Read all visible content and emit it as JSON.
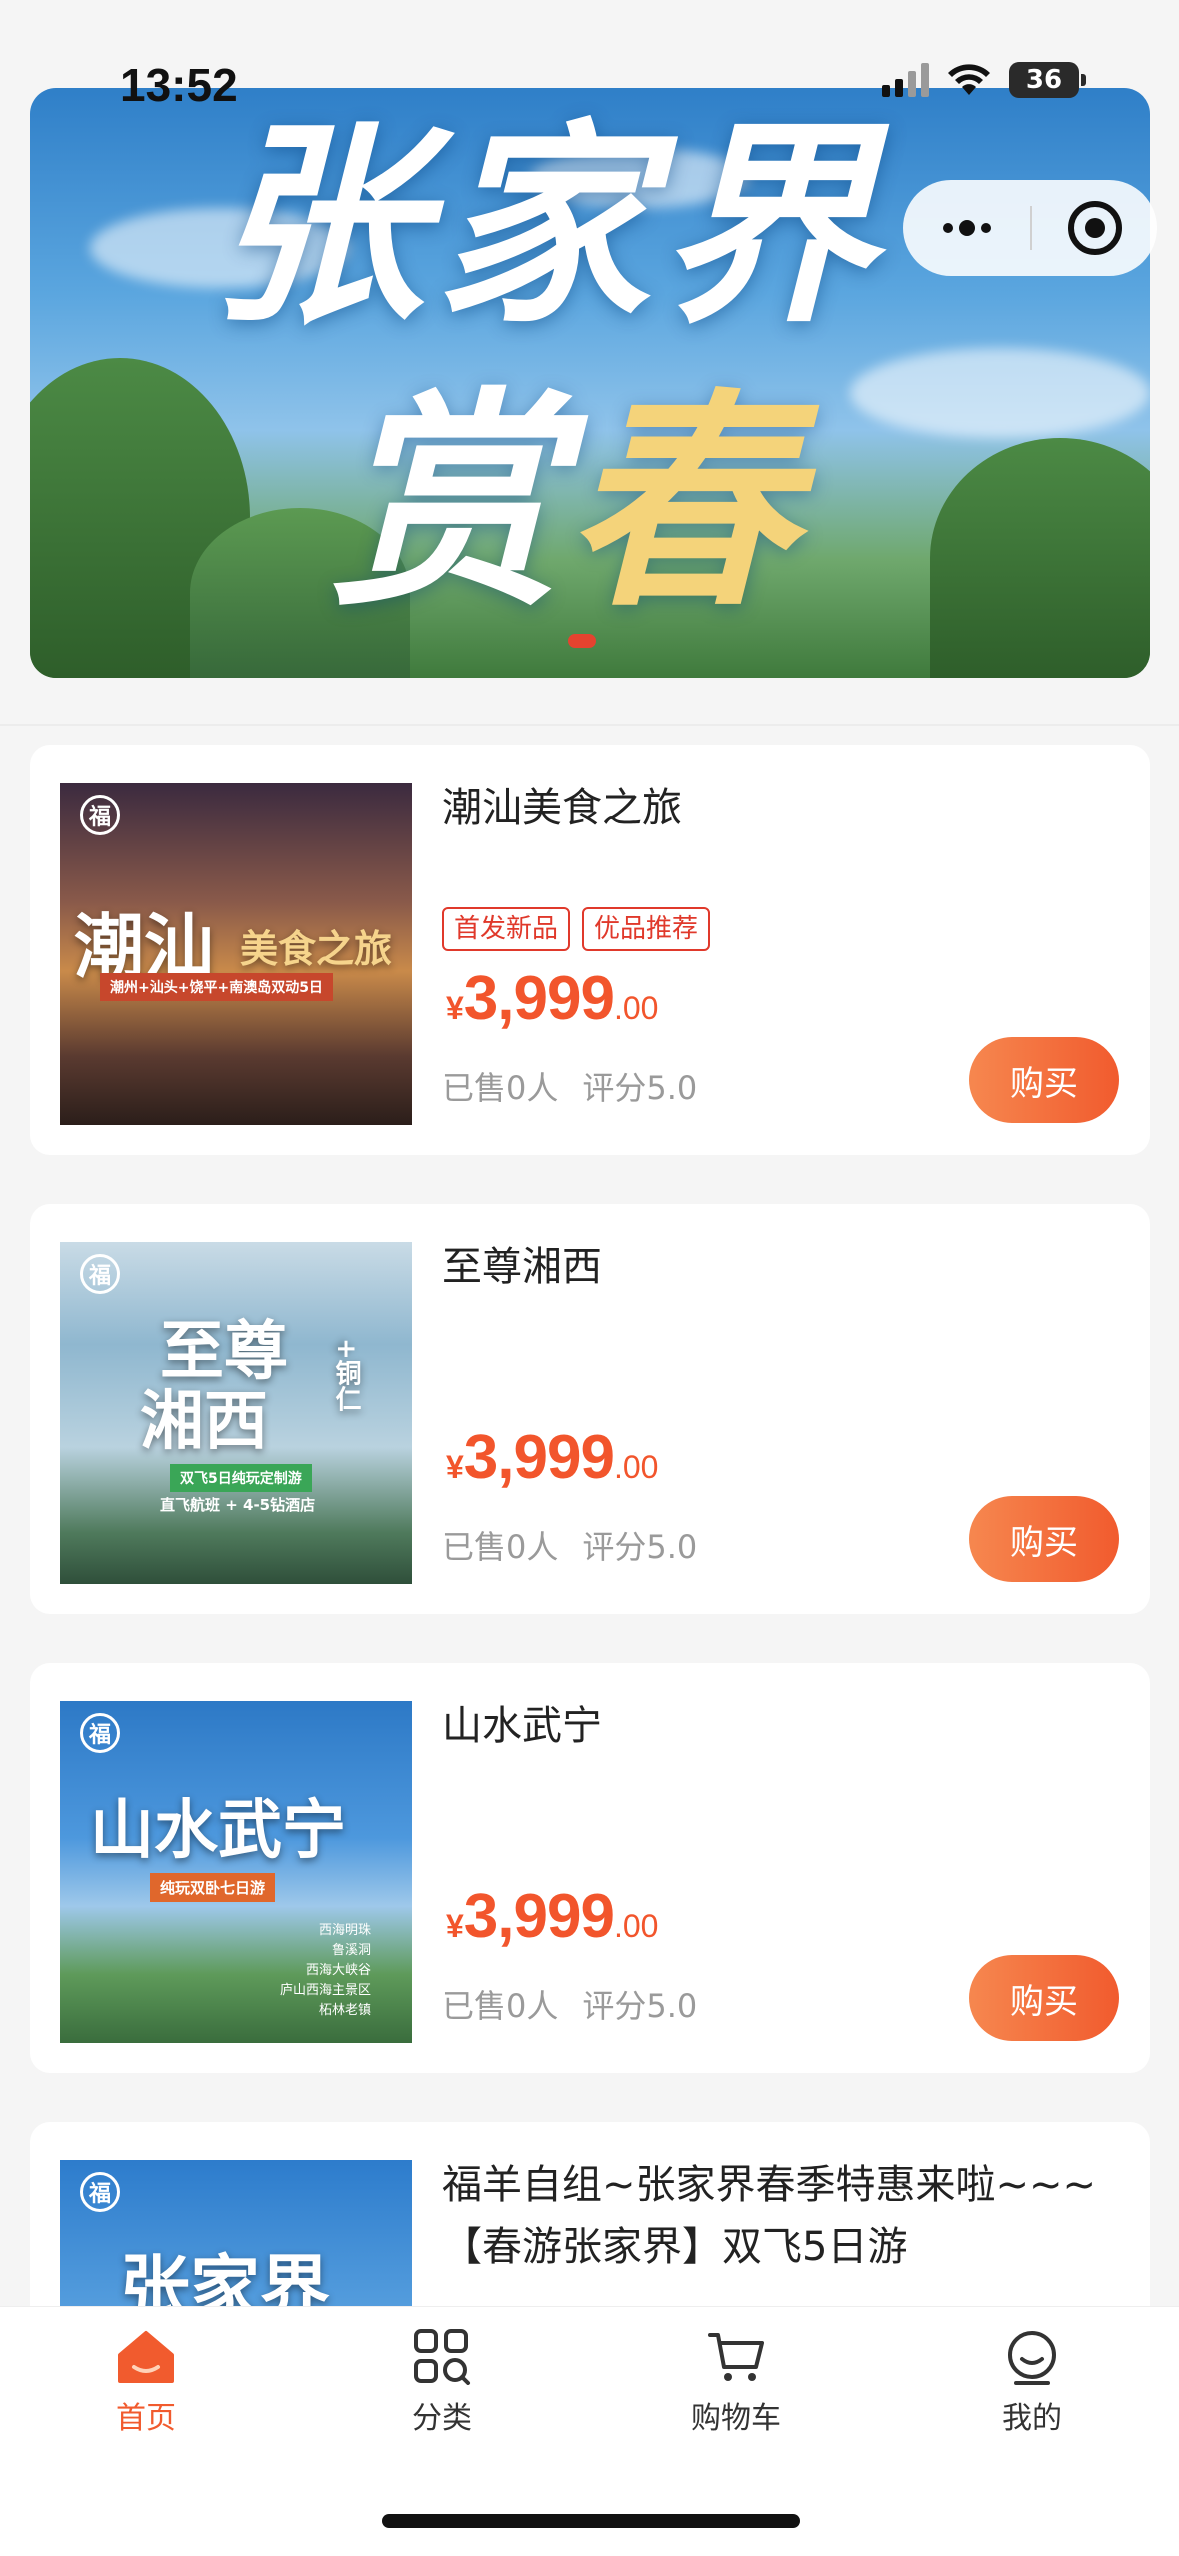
{
  "status_bar": {
    "time": "13:52",
    "battery": "36"
  },
  "banner": {
    "title_line1": "张家界",
    "title_line2_white": "赏",
    "title_line2_yellow": "春"
  },
  "products": [
    {
      "title": "潮汕美食之旅",
      "tags": [
        "首发新品",
        "优品推荐"
      ],
      "price_symbol": "¥",
      "price_int": "3,999",
      "price_dec": ".00",
      "sold": "已售0人",
      "rating": "评分5.0",
      "buy_label": "购买",
      "thumb": {
        "big": "潮汕",
        "sub": "美食之旅",
        "ribbon": "潮州+汕头+饶平+南澳岛双动5日"
      }
    },
    {
      "title": "至尊湘西",
      "tags": [],
      "price_symbol": "¥",
      "price_int": "3,999",
      "price_dec": ".00",
      "sold": "已售0人",
      "rating": "评分5.0",
      "buy_label": "购买",
      "thumb": {
        "big1": "至尊",
        "big2": "湘西",
        "side": "+铜仁",
        "ribbon": "双飞5日纯玩定制游",
        "line": "直飞航班 + 4-5钻酒店"
      }
    },
    {
      "title": "山水武宁",
      "tags": [],
      "price_symbol": "¥",
      "price_int": "3,999",
      "price_dec": ".00",
      "sold": "已售0人",
      "rating": "评分5.0",
      "buy_label": "购买",
      "thumb": {
        "big": "山水武宁",
        "ribbon": "纯玩双卧七日游",
        "list": [
          "西海明珠",
          "鲁溪洞",
          "西海大峡谷",
          "庐山西海主景区",
          "柘林老镇"
        ]
      }
    },
    {
      "title": "福羊自组~张家界春季特惠来啦~~~【春游张家界】双飞5日游",
      "thumb": {
        "big": "张家界"
      }
    }
  ],
  "tabbar": [
    {
      "label": "首页",
      "icon": "home-icon",
      "active": true
    },
    {
      "label": "分类",
      "icon": "category-grid-icon",
      "active": false
    },
    {
      "label": "购物车",
      "icon": "cart-icon",
      "active": false
    },
    {
      "label": "我的",
      "icon": "profile-icon",
      "active": false
    }
  ],
  "colors": {
    "accent": "#f15b2e",
    "tag": "#e0392b",
    "background": "#f5f5f5"
  }
}
